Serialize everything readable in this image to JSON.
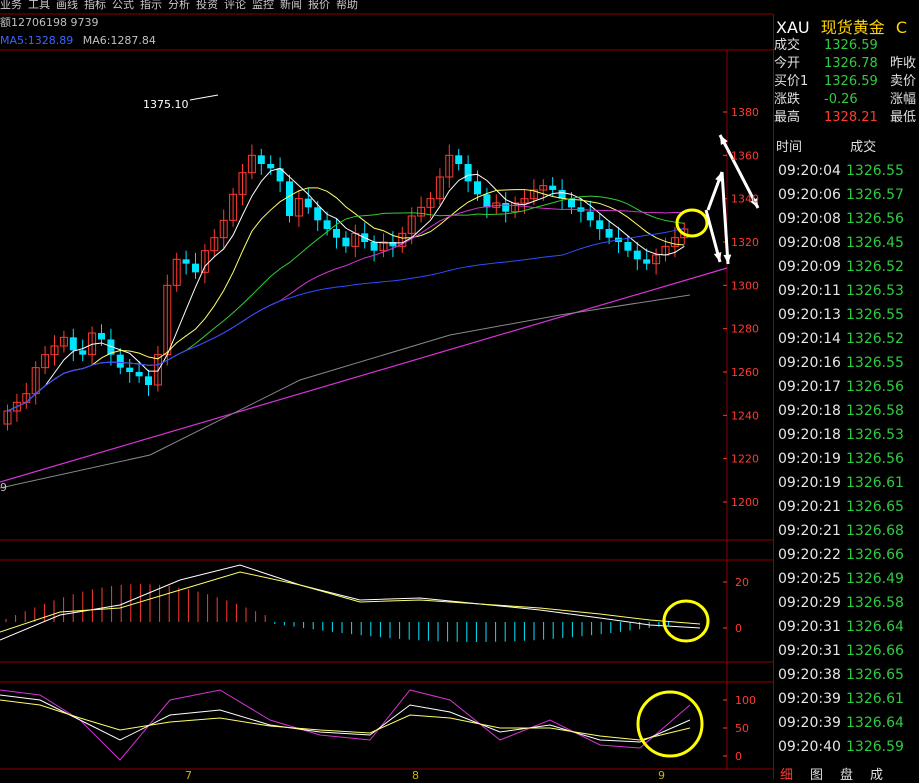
{
  "top_menu": [
    "业务",
    "工具",
    "画线",
    "指标",
    "公式",
    "指示",
    "分析",
    "投资",
    "评论",
    "监控",
    "新闻",
    "报价",
    "帮助"
  ],
  "info": {
    "volume_text": "额12706198 9739",
    "ma5": "MA5:1328.89",
    "ma6": "MA6:1287.84"
  },
  "main_chart": {
    "peak_label": "1375.10",
    "y_ticks": [
      "1380",
      "1360",
      "1340",
      "1320",
      "1300",
      "1280",
      "1260",
      "1240",
      "1220",
      "1200"
    ],
    "left_edge_label": "9",
    "dates": [
      "7",
      "8",
      "9"
    ]
  },
  "macd_ticks": [
    "20",
    "0"
  ],
  "kdj_ticks": [
    "100",
    "50",
    "0"
  ],
  "colors": {
    "up": "#ff3b30",
    "down": "#00e5ff",
    "ma_white": "#ffffff",
    "ma_yellow": "#ffff66",
    "ma_green": "#33cc33",
    "ma_magenta": "#d633d6",
    "ma_blue": "#2f4cff",
    "ma_gray": "#888888",
    "annotation": "#ffff00"
  },
  "quote": {
    "code": "XAU",
    "name": "现货黄金",
    "name_suffix": "C",
    "rows": [
      {
        "label": "成交",
        "value": "1326.59",
        "label2": ""
      },
      {
        "label": "今开",
        "value": "1326.78",
        "label2": "昨收"
      },
      {
        "label": "买价1",
        "value": "1326.59",
        "label2": "卖价"
      },
      {
        "label": "涨跌",
        "value": "-0.26",
        "label2": "涨幅"
      },
      {
        "label": "最高",
        "value": "1328.21",
        "label2": "最低"
      }
    ]
  },
  "ticks_header": {
    "time": "时间",
    "price": "成交"
  },
  "ticks": [
    {
      "time": "09:20:04",
      "price": "1326.55"
    },
    {
      "time": "09:20:06",
      "price": "1326.57"
    },
    {
      "time": "09:20:08",
      "price": "1326.56"
    },
    {
      "time": "09:20:08",
      "price": "1326.45"
    },
    {
      "time": "09:20:09",
      "price": "1326.52"
    },
    {
      "time": "09:20:11",
      "price": "1326.53"
    },
    {
      "time": "09:20:13",
      "price": "1326.55"
    },
    {
      "time": "09:20:14",
      "price": "1326.52"
    },
    {
      "time": "09:20:16",
      "price": "1326.55"
    },
    {
      "time": "09:20:17",
      "price": "1326.56"
    },
    {
      "time": "09:20:18",
      "price": "1326.58"
    },
    {
      "time": "09:20:18",
      "price": "1326.53"
    },
    {
      "time": "09:20:19",
      "price": "1326.56"
    },
    {
      "time": "09:20:19",
      "price": "1326.61"
    },
    {
      "time": "09:20:21",
      "price": "1326.65"
    },
    {
      "time": "09:20:21",
      "price": "1326.68"
    },
    {
      "time": "09:20:22",
      "price": "1326.66"
    },
    {
      "time": "09:20:25",
      "price": "1326.49"
    },
    {
      "time": "09:20:29",
      "price": "1326.58"
    },
    {
      "time": "09:20:31",
      "price": "1326.64"
    },
    {
      "time": "09:20:31",
      "price": "1326.66"
    },
    {
      "time": "09:20:38",
      "price": "1326.65"
    },
    {
      "time": "09:20:39",
      "price": "1326.61"
    },
    {
      "time": "09:20:39",
      "price": "1326.64"
    },
    {
      "time": "09:20:40",
      "price": "1326.59"
    }
  ],
  "bottom_tabs": [
    "细",
    "图",
    "盘",
    "成"
  ]
}
